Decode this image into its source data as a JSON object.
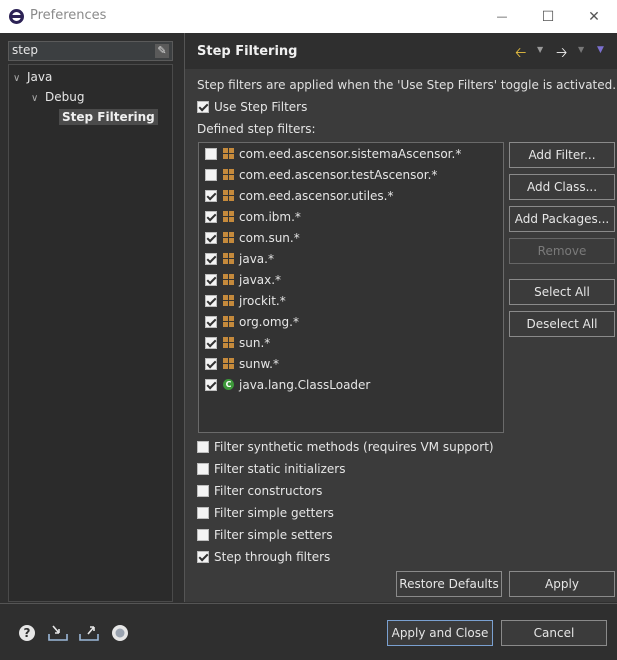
{
  "window": {
    "title": "Preferences",
    "minimize_glyph": "—",
    "maximize_glyph": "☐",
    "close_glyph": "✕"
  },
  "left": {
    "filter_value": "step",
    "tree": [
      {
        "label": "Java",
        "level": 0,
        "expanded": true
      },
      {
        "label": "Debug",
        "level": 1,
        "expanded": true
      },
      {
        "label": "Step Filtering",
        "level": 2,
        "selected": true
      }
    ]
  },
  "page": {
    "title": "Step Filtering",
    "description": "Step filters are applied when the 'Use Step Filters' toggle is activated.",
    "use_step_filters_label": "Use Step Filters",
    "use_step_filters_checked": true,
    "defined_label": "Defined step filters:",
    "filters": [
      {
        "label": "com.eed.ascensor.sistemaAscensor.*",
        "checked": false,
        "icon": "package-icon"
      },
      {
        "label": "com.eed.ascensor.testAscensor.*",
        "checked": false,
        "icon": "package-icon"
      },
      {
        "label": "com.eed.ascensor.utiles.*",
        "checked": true,
        "icon": "package-icon"
      },
      {
        "label": "com.ibm.*",
        "checked": true,
        "icon": "package-icon"
      },
      {
        "label": "com.sun.*",
        "checked": true,
        "icon": "package-icon"
      },
      {
        "label": "java.*",
        "checked": true,
        "icon": "package-icon"
      },
      {
        "label": "javax.*",
        "checked": true,
        "icon": "package-icon"
      },
      {
        "label": "jrockit.*",
        "checked": true,
        "icon": "package-icon"
      },
      {
        "label": "org.omg.*",
        "checked": true,
        "icon": "package-icon"
      },
      {
        "label": "sun.*",
        "checked": true,
        "icon": "package-icon"
      },
      {
        "label": "sunw.*",
        "checked": true,
        "icon": "package-icon"
      },
      {
        "label": "java.lang.ClassLoader",
        "checked": true,
        "icon": "class-icon"
      }
    ],
    "side_buttons": {
      "add_filter": "Add Filter...",
      "add_class": "Add Class...",
      "add_packages": "Add Packages...",
      "remove": "Remove",
      "select_all": "Select All",
      "deselect_all": "Deselect All"
    },
    "options": [
      {
        "label": "Filter synthetic methods (requires VM support)",
        "checked": false
      },
      {
        "label": "Filter static initializers",
        "checked": false
      },
      {
        "label": "Filter constructors",
        "checked": false
      },
      {
        "label": "Filter simple getters",
        "checked": false
      },
      {
        "label": "Filter simple setters",
        "checked": false
      },
      {
        "label": "Step through filters",
        "checked": true
      }
    ],
    "restore_defaults": "Restore Defaults",
    "apply": "Apply"
  },
  "footer": {
    "apply_and_close": "Apply and Close",
    "cancel": "Cancel"
  },
  "colors": {
    "accent_back": "#e8c040",
    "accent_forward": "#f0f0f0",
    "dropdown": "#7b6fd0"
  }
}
